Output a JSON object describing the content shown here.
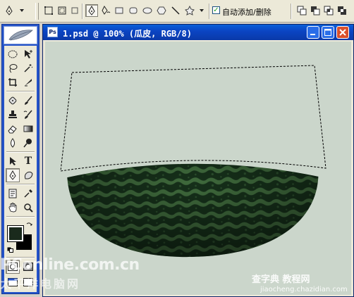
{
  "options_bar": {
    "tool_icons": [
      "pen-tool-icon",
      "shape-layers-icon",
      "paths-icon",
      "fill-pixels-icon",
      "pen-icon",
      "freeform-pen-icon",
      "rectangle-icon",
      "rounded-rectangle-icon",
      "ellipse-icon",
      "polygon-icon",
      "line-icon",
      "custom-shape-icon",
      "dropdown-icon"
    ],
    "auto_add_delete_checked": true,
    "auto_add_delete_label": "自动添加/删除",
    "combine_icons": [
      "add-to-shape-icon",
      "subtract-from-shape-icon",
      "intersect-shape-icon",
      "exclude-overlap-icon"
    ]
  },
  "toolbox": {
    "tools": [
      [
        "marquee-tool-icon",
        "move-tool-icon"
      ],
      [
        "lasso-tool-icon",
        "magic-wand-icon"
      ],
      [
        "crop-tool-icon",
        "slice-tool-icon"
      ],
      [
        "healing-brush-icon",
        "brush-tool-icon"
      ],
      [
        "clone-stamp-icon",
        "history-brush-icon"
      ],
      [
        "eraser-tool-icon",
        "gradient-tool-icon"
      ],
      [
        "blur-tool-icon",
        "dodge-tool-icon"
      ],
      [
        "path-selection-icon",
        "type-tool-icon"
      ],
      [
        "pen-tool-icon",
        "custom-shape-tool-icon"
      ],
      [
        "notes-tool-icon",
        "eyedropper-tool-icon"
      ],
      [
        "hand-tool-icon",
        "zoom-tool-icon"
      ]
    ],
    "active_tool": "pen-tool-icon",
    "foreground_color": "#1a2a1c",
    "background_color": "#000000"
  },
  "document": {
    "title": "1.psd @ 100% (瓜皮, RGB/8)",
    "canvas_color": "#cbd6cb",
    "watermelon_dark": "#16301a",
    "watermelon_light": "#3f6a3c"
  },
  "watermarks": {
    "site_line1": "PConline.com.cn",
    "site_line2": "太平洋电脑网",
    "corner_line1": "查字典 教程网",
    "corner_line2": "jiaocheng.chazidian.com"
  }
}
